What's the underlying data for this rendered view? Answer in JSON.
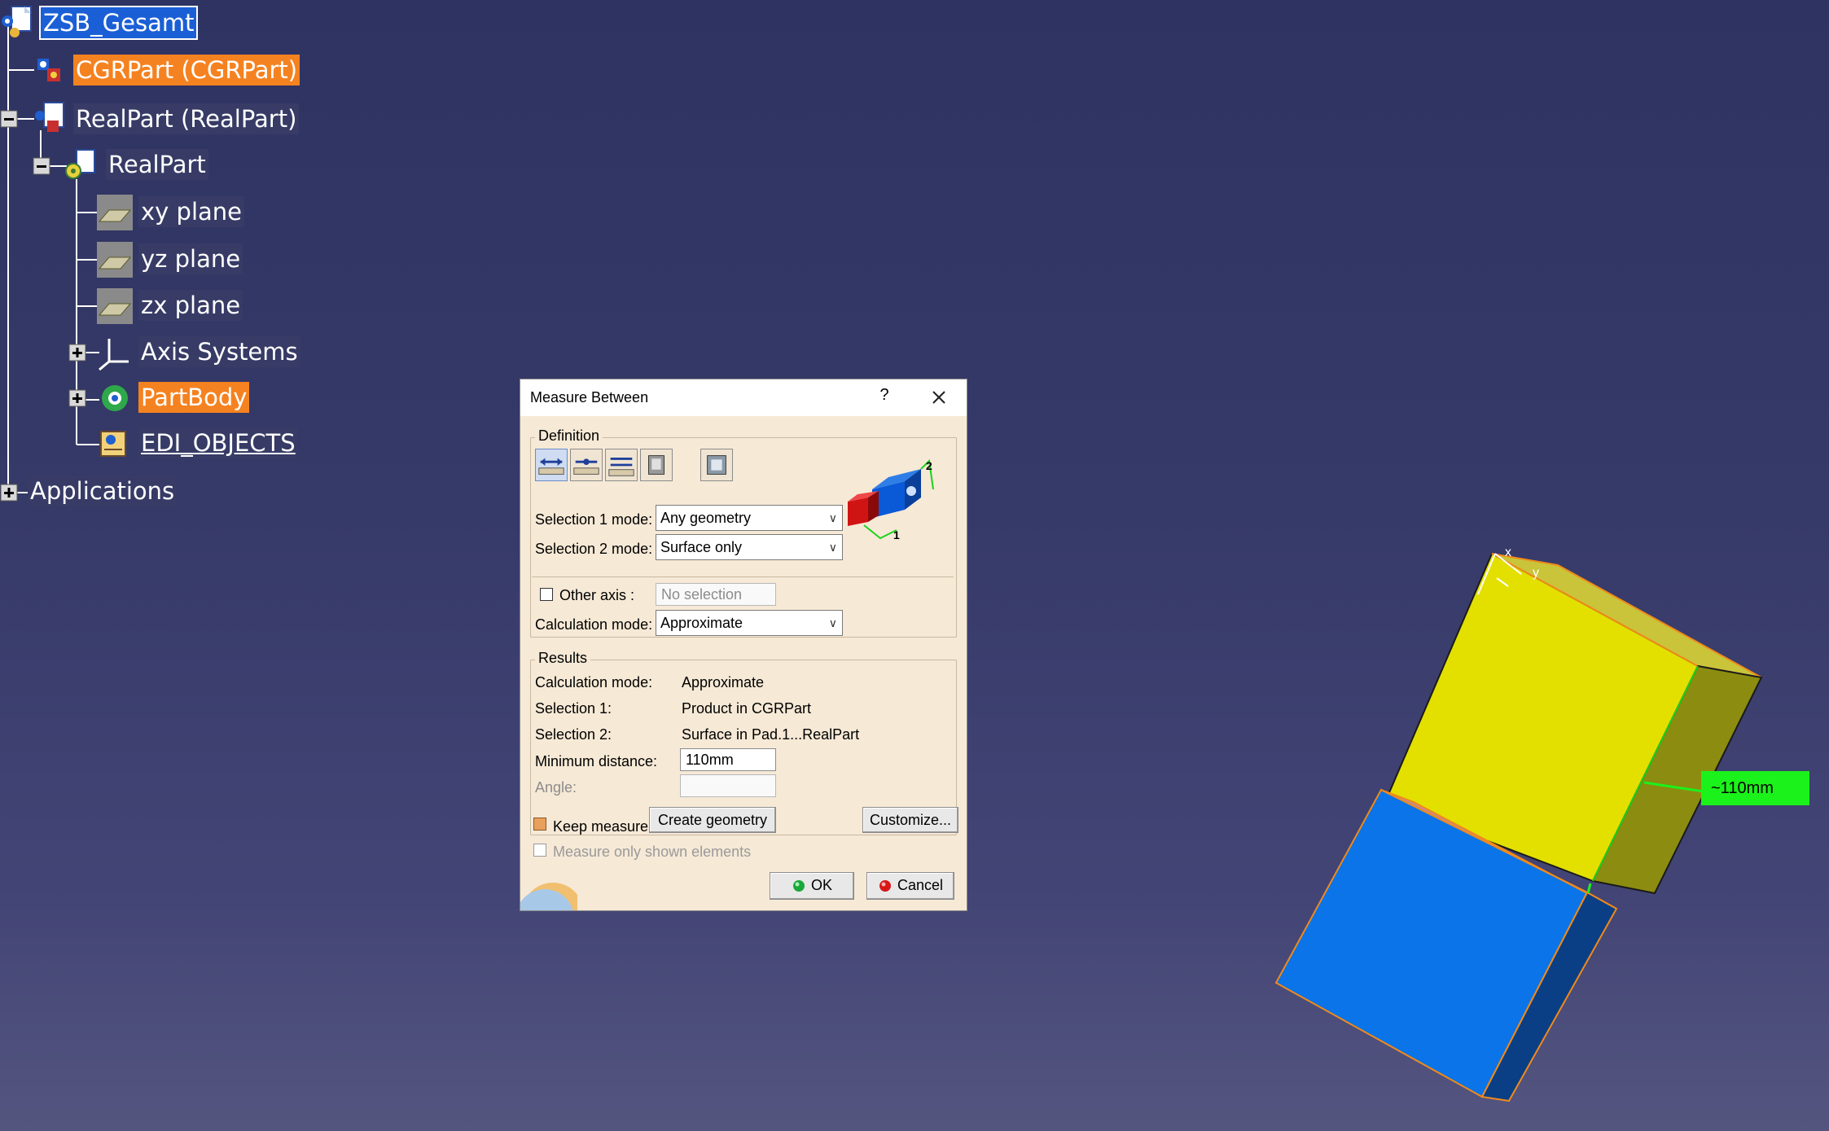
{
  "spec_tree": {
    "root": "ZSB_Gesamt",
    "items": [
      {
        "key": "cgrpart",
        "label": "CGRPart (CGRPart)"
      },
      {
        "key": "realpart_product",
        "label": "RealPart (RealPart)"
      },
      {
        "key": "realpart",
        "label": "RealPart"
      },
      {
        "key": "xy",
        "label": "xy plane"
      },
      {
        "key": "yz",
        "label": "yz plane"
      },
      {
        "key": "zx",
        "label": "zx plane"
      },
      {
        "key": "axis",
        "label": "Axis Systems"
      },
      {
        "key": "partbody",
        "label": "PartBody"
      },
      {
        "key": "edi",
        "label": "EDI_OBJECTS"
      },
      {
        "key": "apps",
        "label": "Applications"
      }
    ]
  },
  "dialog": {
    "title": "Measure Between",
    "help_glyph": "?",
    "definition": {
      "group_label": "Definition",
      "selection1_label": "Selection 1 mode:",
      "selection1_value": "Any geometry",
      "selection2_label": "Selection 2 mode:",
      "selection2_value": "Surface only",
      "other_axis_label": "Other axis :",
      "other_axis_placeholder": "No selection",
      "calc_mode_label": "Calculation mode:",
      "calc_mode_value": "Approximate",
      "preview_labels": {
        "one": "1",
        "two": "2"
      }
    },
    "results": {
      "group_label": "Results",
      "rows": [
        {
          "label": "Calculation mode:",
          "value": "Approximate"
        },
        {
          "label": "Selection 1:",
          "value": "Product in CGRPart"
        },
        {
          "label": "Selection 2:",
          "value": "Surface in Pad.1...RealPart"
        }
      ],
      "min_distance_label": "Minimum distance:",
      "min_distance_value": "110mm",
      "angle_label": "Angle:",
      "angle_value": ""
    },
    "keep_measure_label": "Keep measure",
    "create_geometry_label": "Create geometry",
    "customize_label": "Customize...",
    "measure_only_label": "Measure only shown elements",
    "ok_label": "OK",
    "cancel_label": "Cancel"
  },
  "viewer": {
    "dimension_label": "~110mm",
    "compass": {
      "x": "x",
      "y": "y"
    }
  },
  "colors": {
    "background": "#363a68",
    "tree_selected_blue": "#1b5fd6",
    "tree_selected_orange": "#f58220",
    "yellow_solid": "#e3e000",
    "blue_solid": "#0a74e8",
    "dimension_tag": "#1bf21b",
    "edge_highlight": "#f08a1a"
  }
}
